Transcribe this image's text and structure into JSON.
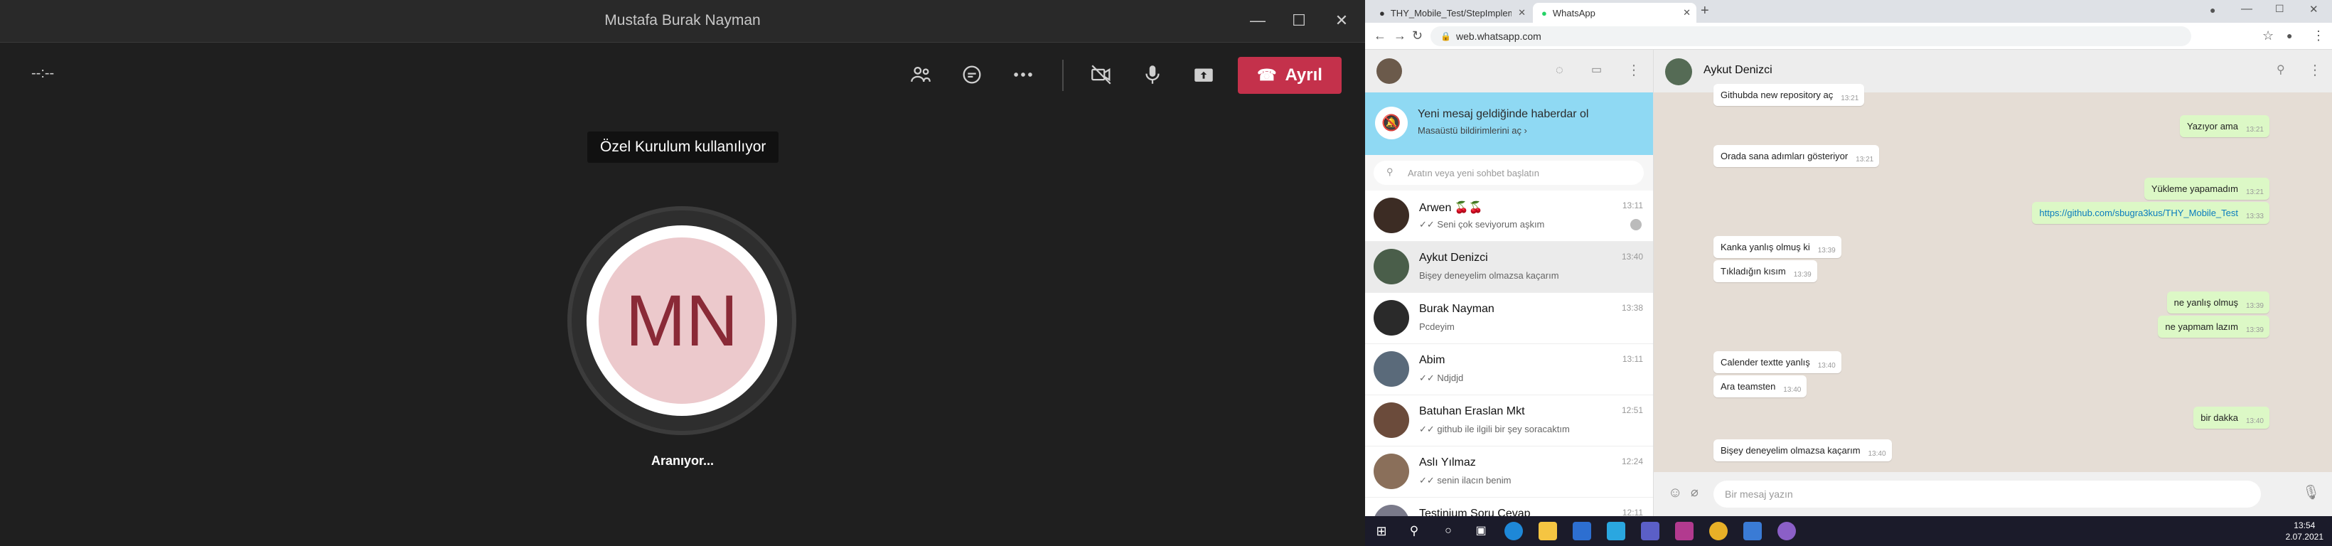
{
  "teams": {
    "window_title": "Mustafa Burak Nayman",
    "timer": "--:--",
    "leave_label": "Ayrıl",
    "tooltip": "Özel Kurulum kullanılıyor",
    "avatar_initials": "MN",
    "status": "Aranıyor..."
  },
  "chrome": {
    "tabs": [
      {
        "title": "THY_Mobile_Test/StepImplemen"
      },
      {
        "title": "WhatsApp"
      }
    ],
    "url": "web.whatsapp.com"
  },
  "whatsapp": {
    "notif_title": "Yeni mesaj geldiğinde haberdar ol",
    "notif_sub": "Masaüstü bildirimlerini aç ›",
    "search_placeholder": "Aratın veya yeni sohbet başlatın",
    "chats": [
      {
        "name": "Arwen 🍒🍒",
        "preview": "✓✓ Seni çok seviyorum aşkım",
        "time": "13:11"
      },
      {
        "name": "Aykut Denizci",
        "preview": "Bişey deneyelim olmazsa kaçarım",
        "time": "13:40"
      },
      {
        "name": "Burak Nayman",
        "preview": "Pcdeyim",
        "time": "13:38"
      },
      {
        "name": "Abim",
        "preview": "✓✓ Ndjdjd",
        "time": "13:11"
      },
      {
        "name": "Batuhan Eraslan Mkt",
        "preview": "✓✓ github ile ilgili bir şey soracaktım",
        "time": "12:51"
      },
      {
        "name": "Aslı Yılmaz",
        "preview": "✓✓ senin ilacın benim",
        "time": "12:24"
      },
      {
        "name": "Testinium Soru Cevap",
        "preview": "",
        "time": "12:11"
      }
    ],
    "active_chat": "Aykut Denizci",
    "messages": [
      {
        "dir": "in",
        "text": "Githubda new repository aç",
        "time": "13:21"
      },
      {
        "dir": "out",
        "text": "Yazıyor ama",
        "time": "13:21"
      },
      {
        "dir": "in",
        "text": "Orada sana adımları gösteriyor",
        "time": "13:21"
      },
      {
        "dir": "out",
        "text": "Yükleme yapamadım",
        "time": "13:21"
      },
      {
        "dir": "out",
        "text": "https://github.com/sbugra3kus/THY_Mobile_Test",
        "time": "13:33"
      },
      {
        "dir": "in",
        "text": "Kanka yanlış olmuş ki",
        "time": "13:39"
      },
      {
        "dir": "in",
        "text": "Tıkladığın kısım",
        "time": "13:39"
      },
      {
        "dir": "out",
        "text": "ne yanlış olmuş",
        "time": "13:39"
      },
      {
        "dir": "out",
        "text": "ne yapmam lazım",
        "time": "13:39"
      },
      {
        "dir": "in",
        "text": "Calender textte yanlış",
        "time": "13:40"
      },
      {
        "dir": "in",
        "text": "Ara teamsten",
        "time": "13:40"
      },
      {
        "dir": "out",
        "text": "bir dakka",
        "time": "13:40"
      },
      {
        "dir": "in",
        "text": "Bişey deneyelim olmazsa kaçarım",
        "time": "13:40"
      }
    ],
    "composer_placeholder": "Bir mesaj yazın"
  },
  "taskbar": {
    "time": "13:54",
    "date": "2.07.2021"
  },
  "colors": {
    "teams_leave": "#c4314b",
    "wa_notif": "#8fd9f3",
    "wa_out": "#dcf8c6",
    "wa_bg": "#e5ddd5"
  }
}
